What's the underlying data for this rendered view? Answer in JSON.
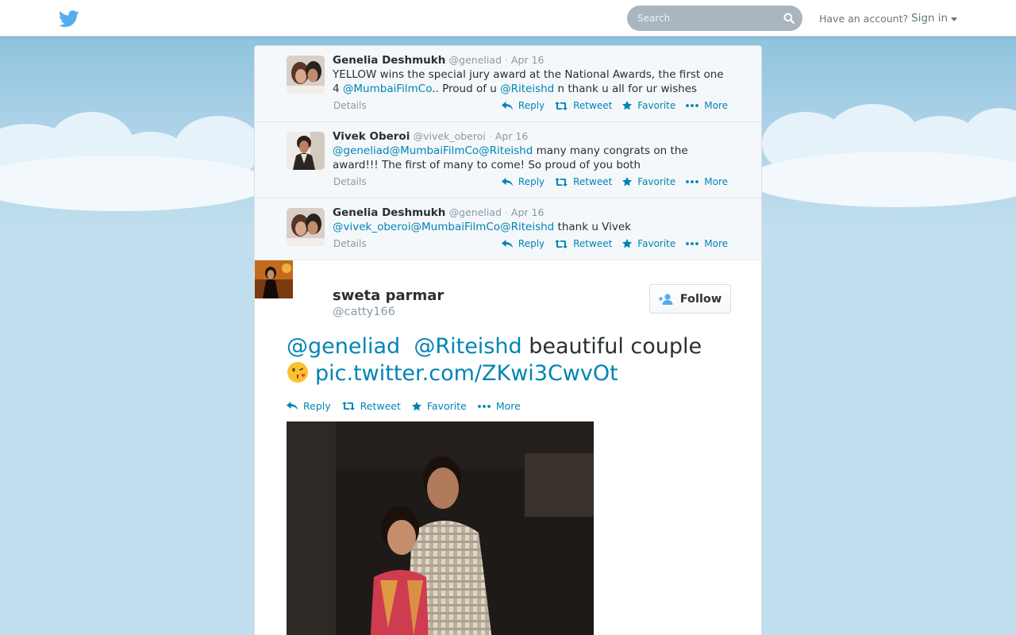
{
  "topbar": {
    "search_placeholder": "Search",
    "have_account": "Have an account?",
    "sign_in": "Sign in"
  },
  "conversation": [
    {
      "fullname": "Genelia Deshmukh",
      "screen_name": "@geneliad",
      "sep": "·",
      "time": "Apr 16",
      "text_parts": [
        {
          "t": "YELLOW wins the special jury award at the National Awards, the first one 4 ",
          "m": false
        },
        {
          "t": "@MumbaiFilmCo",
          "m": true
        },
        {
          "t": ".. Proud of u ",
          "m": false
        },
        {
          "t": "@Riteishd",
          "m": true
        },
        {
          "t": " n thank u all for ur wishes",
          "m": false
        }
      ],
      "details": "Details"
    },
    {
      "fullname": "Vivek Oberoi",
      "screen_name": "@vivek_oberoi",
      "sep": "·",
      "time": "Apr 16",
      "text_parts": [
        {
          "t": "@geneliad",
          "m": true
        },
        {
          "t": "@MumbaiFilmCo",
          "m": true
        },
        {
          "t": "@Riteishd",
          "m": true
        },
        {
          "t": " many many congrats on the award!!! The first of many to come! So proud of you both",
          "m": false
        }
      ],
      "details": "Details"
    },
    {
      "fullname": "Genelia Deshmukh",
      "screen_name": "@geneliad",
      "sep": "·",
      "time": "Apr 16",
      "text_parts": [
        {
          "t": "@vivek_oberoi",
          "m": true
        },
        {
          "t": "@MumbaiFilmCo",
          "m": true
        },
        {
          "t": "@Riteishd",
          "m": true
        },
        {
          "t": " thank u Vivek",
          "m": false
        }
      ],
      "details": "Details"
    }
  ],
  "actions": {
    "reply": "Reply",
    "retweet": "Retweet",
    "favorite": "Favorite",
    "more": "More"
  },
  "permalink": {
    "fullname": "sweta parmar",
    "screen_name": "@catty166",
    "follow": "Follow",
    "mention1": "@geneliad",
    "mention2": "@Riteishd",
    "text": " beautiful couple",
    "link": "pic.twitter.com/ZKwi3CwvOt"
  },
  "colors": {
    "link": "#0084b4",
    "bird": "#55acee",
    "sky": "#c0deed"
  }
}
